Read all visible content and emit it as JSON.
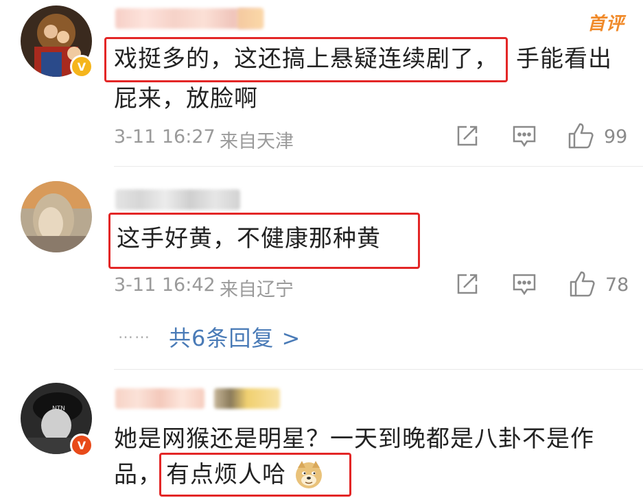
{
  "comments": [
    {
      "text_line1": "戏挺多的，这还搞上悬疑连续剧了，",
      "text_line1_rest": "手能看出",
      "text_line2": "屁来，放脸啊",
      "time": "3-11 16:27",
      "source": "来自天津",
      "likes": "99",
      "badge_color": "#f5b51c",
      "tag": "首评"
    },
    {
      "text_line1": "这手好黄，不健康那种黄",
      "time": "3-11 16:42",
      "source": "来自辽宁",
      "likes": "78",
      "replies_label": "共6条回复 >",
      "dots": "……"
    },
    {
      "text_line1": "她是网猴还是明星？一天到晚都是八卦不是作",
      "text_line2_prefix": "品，",
      "text_line2_boxed": "有点烦人哈",
      "badge_color": "#e84a1a",
      "emoji_icon": "doge-emoji-icon"
    }
  ],
  "icons": [
    "repost-icon",
    "comment-icon",
    "like-icon"
  ],
  "colors": {
    "highlight": "#e32626",
    "link": "#4a7bb7",
    "meta": "#9a9a9a"
  }
}
